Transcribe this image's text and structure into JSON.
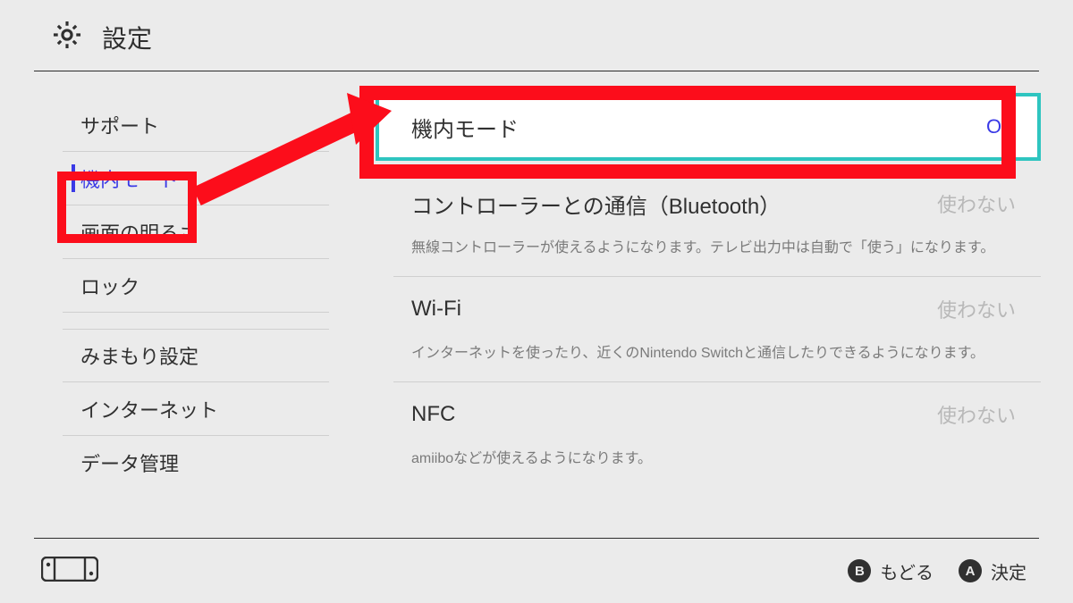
{
  "header": {
    "title": "設定"
  },
  "sidebar": {
    "items": [
      {
        "label": "サポート"
      },
      {
        "label": "機内モード"
      },
      {
        "label": "画面の明るさ"
      },
      {
        "label": "ロック"
      },
      {
        "label": "みまもり設定"
      },
      {
        "label": "インターネット"
      },
      {
        "label": "データ管理"
      }
    ]
  },
  "main": {
    "airplane": {
      "label": "機内モード",
      "value": "ON"
    },
    "bluetooth": {
      "label": "コントローラーとの通信（Bluetooth）",
      "value": "使わない",
      "desc": "無線コントローラーが使えるようになります。テレビ出力中は自動で「使う」になります。"
    },
    "wifi": {
      "label": "Wi-Fi",
      "value": "使わない",
      "desc": "インターネットを使ったり、近くのNintendo Switchと通信したりできるようになります。"
    },
    "nfc": {
      "label": "NFC",
      "value": "使わない",
      "desc": "amiiboなどが使えるようになります。"
    }
  },
  "footer": {
    "back": {
      "glyph": "B",
      "label": "もどる"
    },
    "ok": {
      "glyph": "A",
      "label": "決定"
    }
  }
}
